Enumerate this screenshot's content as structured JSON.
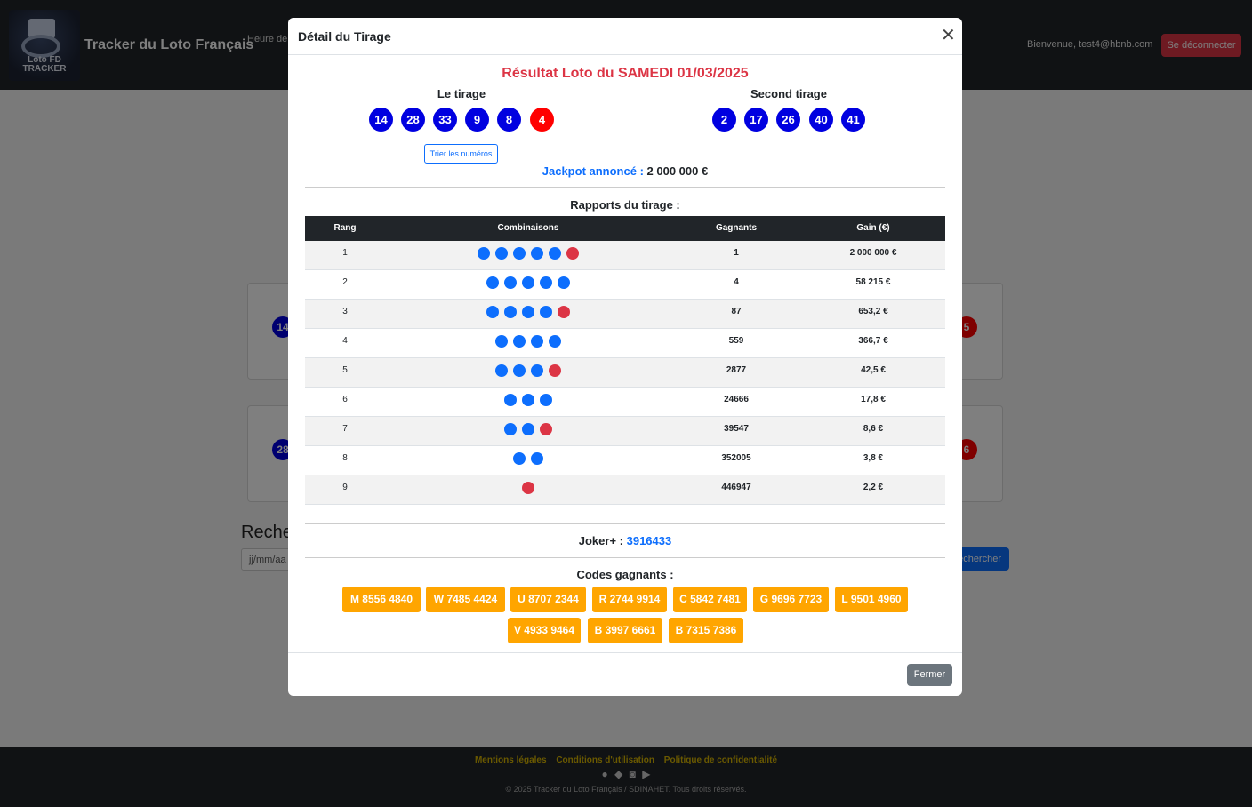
{
  "navbar": {
    "logo_text": [
      "Loto FD",
      "TRACKER"
    ],
    "brand": "Tracker du Loto Français",
    "hour_label": "Heure de",
    "welcome": "Bienvenue, test4@hbnb.com",
    "logout_label": "Se déconnecter"
  },
  "background": {
    "card1_left_ball": "14",
    "card1_right_ball": "5",
    "card2_left_ball": "28",
    "card2_right_ball": "6",
    "search_heading": "Recher",
    "date_placeholder": "jj/mm/aa",
    "search_button": "echercher"
  },
  "modal": {
    "title": "Détail du Tirage",
    "result_title": "Résultat Loto du SAMEDI 01/03/2025",
    "first_draw_label": "Le tirage",
    "second_draw_label": "Second tirage",
    "first_draw_balls": [
      {
        "value": "14",
        "color": "blue"
      },
      {
        "value": "28",
        "color": "blue"
      },
      {
        "value": "33",
        "color": "blue"
      },
      {
        "value": "9",
        "color": "blue"
      },
      {
        "value": "8",
        "color": "blue"
      },
      {
        "value": "4",
        "color": "red"
      }
    ],
    "second_draw_balls": [
      "2",
      "17",
      "26",
      "40",
      "41"
    ],
    "sort_button": "Trier les numéros",
    "jackpot_label": "Jackpot annoncé :",
    "jackpot_value": "2 000 000 €",
    "rapports_title": "Rapports du tirage :",
    "table": {
      "headers": [
        "Rang",
        "Combinaisons",
        "Gagnants",
        "Gain (€)"
      ],
      "rows": [
        {
          "rang": "1",
          "blue": 5,
          "red": 1,
          "gagnants": "1",
          "gain": "2 000 000 €"
        },
        {
          "rang": "2",
          "blue": 5,
          "red": 0,
          "gagnants": "4",
          "gain": "58 215 €"
        },
        {
          "rang": "3",
          "blue": 4,
          "red": 1,
          "gagnants": "87",
          "gain": "653,2 €"
        },
        {
          "rang": "4",
          "blue": 4,
          "red": 0,
          "gagnants": "559",
          "gain": "366,7 €"
        },
        {
          "rang": "5",
          "blue": 3,
          "red": 1,
          "gagnants": "2877",
          "gain": "42,5 €"
        },
        {
          "rang": "6",
          "blue": 3,
          "red": 0,
          "gagnants": "24666",
          "gain": "17,8 €"
        },
        {
          "rang": "7",
          "blue": 2,
          "red": 1,
          "gagnants": "39547",
          "gain": "8,6 €"
        },
        {
          "rang": "8",
          "blue": 2,
          "red": 0,
          "gagnants": "352005",
          "gain": "3,8 €"
        },
        {
          "rang": "9",
          "blue": 0,
          "red": 1,
          "gagnants": "446947",
          "gain": "2,2 €"
        }
      ]
    },
    "joker_label": "Joker+ :",
    "joker_value": "3916433",
    "codes_title": "Codes gagnants :",
    "codes": [
      "M 8556 4840",
      "W 7485 4424",
      "U 8707 2344",
      "R 2744 9914",
      "C 5842 7481",
      "G 9696 7723",
      "L 9501 4960",
      "V 4933 9464",
      "B 3997 6661",
      "B 7315 7386"
    ],
    "close_button": "Fermer"
  },
  "footer": {
    "links": [
      "Mentions légales",
      "Conditions d'utilisation",
      "Politique de confidentialité"
    ],
    "social_icons": [
      "facebook-icon",
      "twitter-icon",
      "instagram-icon",
      "youtube-icon"
    ],
    "copyright": "© 2025 Tracker du Loto Français / SDINAHET. Tous droits réservés."
  },
  "colors": {
    "ball_blue": "#0000e0",
    "ball_red": "#ff0000",
    "combo_blue": "#0d6efd",
    "combo_red": "#dc3545",
    "code_orange": "#ffa500",
    "accent_red": "#dc3545"
  }
}
